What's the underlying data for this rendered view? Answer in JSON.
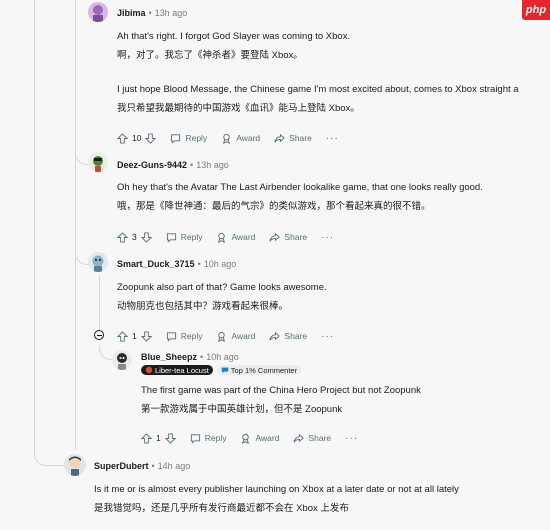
{
  "watermark": "php",
  "comments": [
    {
      "author": "Jibima",
      "time": "13h ago",
      "lines": [
        "Ah that's right. I forgot God Slayer was coming to Xbox.",
        "啊，对了。我忘了《神杀者》要登陆 Xbox。",
        "I just hope Blood Message, the Chinese game I'm most excited about, comes to Xbox straight a",
        "我只希望我最期待的中国游戏《血讯》能马上登陆 Xbox。"
      ],
      "votes": "10",
      "reply": "Reply",
      "award": "Award",
      "share": "Share",
      "more": "···"
    },
    {
      "author": "Deez-Guns-9442",
      "time": "13h ago",
      "lines": [
        "Oh hey that's the Avatar The Last Airbender lookalike game, that one looks really good.",
        "哦，那是《降世神通：最后的气宗》的类似游戏，那个看起来真的很不错。"
      ],
      "votes": "3",
      "reply": "Reply",
      "award": "Award",
      "share": "Share",
      "more": "···"
    },
    {
      "author": "Smart_Duck_3715",
      "time": "10h ago",
      "lines": [
        "Zoopunk also part of that? Game looks awesome.",
        "动物朋克也包括其中？游戏看起来很棒。"
      ],
      "votes": "1",
      "reply": "Reply",
      "award": "Award",
      "share": "Share",
      "more": "···"
    },
    {
      "author": "Blue_Sheepz",
      "time": "10h ago",
      "badge1": "Liber-tea Locust",
      "badge2": "Top 1% Commenter",
      "lines": [
        "The first game was part of the China Hero Project but not Zoopunk",
        "第一款游戏属于中国英雄计划，但不是 Zoopunk"
      ],
      "votes": "1",
      "reply": "Reply",
      "award": "Award",
      "share": "Share",
      "more": "···"
    },
    {
      "author": "SuperDubert",
      "time": "14h ago",
      "lines": [
        "Is it me or is almost every publisher launching on Xbox at a later date or not at all lately",
        "是我错觉吗，还是几乎所有发行商最近都不会在 Xbox 上发布"
      ]
    }
  ]
}
